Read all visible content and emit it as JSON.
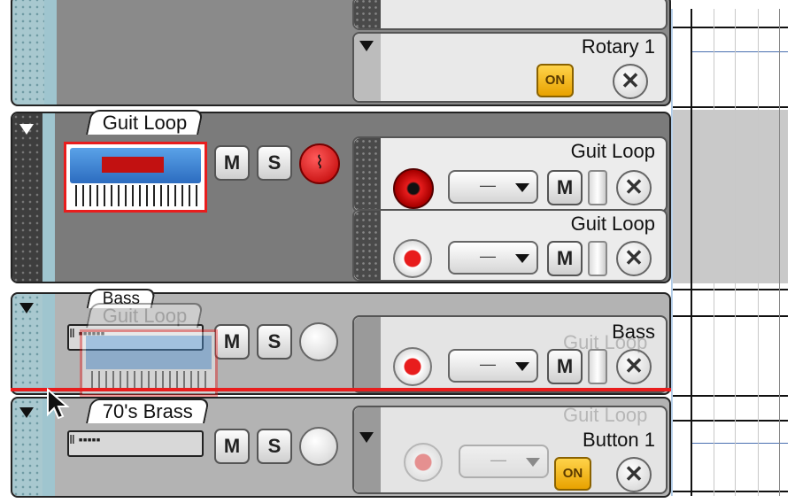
{
  "tracks": {
    "rotary_panel": {
      "label": "Rotary 1",
      "on_label": "ON"
    },
    "guit_loop": {
      "name": "Guit Loop",
      "mute_label": "M",
      "solo_label": "S",
      "lanes": [
        {
          "label": "Guit Loop",
          "dropdown_value": "—",
          "mute_label": "M"
        },
        {
          "label": "Guit Loop",
          "dropdown_value": "—",
          "mute_label": "M"
        }
      ]
    },
    "bass": {
      "name": "Bass",
      "mute_label": "M",
      "solo_label": "S",
      "lane": {
        "label": "Bass",
        "dropdown_value": "—",
        "mute_label": "M"
      }
    },
    "brass": {
      "name": "70's Brass",
      "mute_label": "M",
      "solo_label": "S",
      "lane": {
        "label": "Button 1",
        "dropdown_value": "—",
        "on_label": "ON"
      }
    }
  },
  "drag_ghost": {
    "name": "Guit Loop",
    "lane_label_1": "Guit Loop",
    "lane_label_2": "Guit Loop"
  },
  "colors": {
    "accent_red": "#e81d1d",
    "splitter_blue": "#a9c6e4",
    "on_yellow": "#f2b51a"
  },
  "icons": [
    "pointer-cursor-icon",
    "disclosure-triangle-icon",
    "close-x-icon",
    "lfo-wave-icon",
    "record-icon"
  ]
}
